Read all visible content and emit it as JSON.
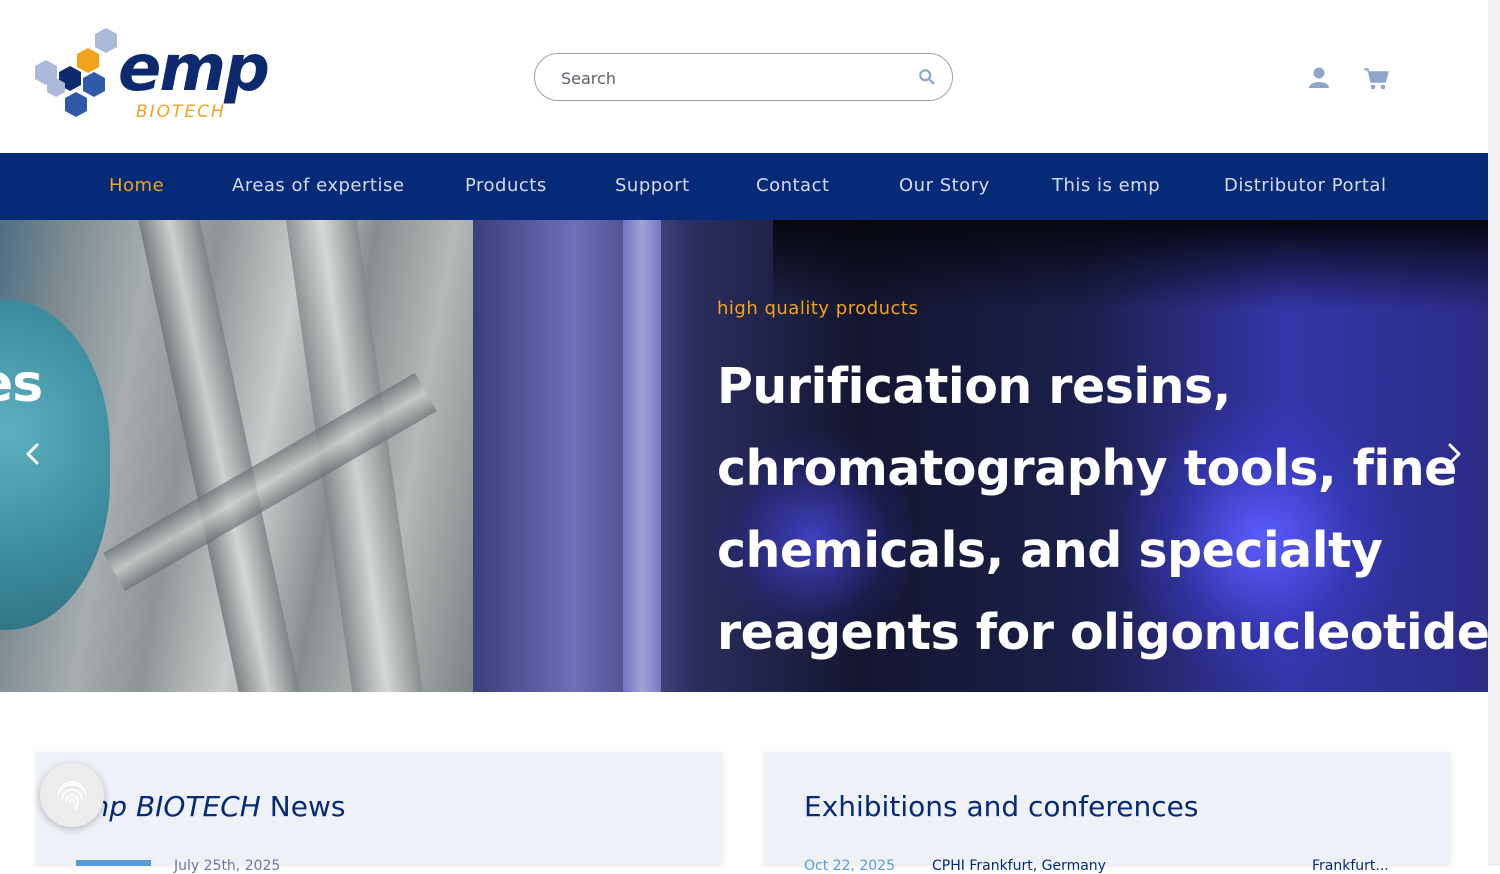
{
  "brand": {
    "name": "emp",
    "sub": "BIOTECH",
    "colors": {
      "navy": "#052a78",
      "orange": "#f0a31b",
      "lightblue": "#8fa6c9"
    }
  },
  "search": {
    "placeholder": "Search",
    "icon": "search-icon"
  },
  "header_icons": [
    "user-icon",
    "cart-icon"
  ],
  "nav": {
    "items": [
      {
        "label": "Home",
        "active": true
      },
      {
        "label": "Areas of expertise"
      },
      {
        "label": "Products"
      },
      {
        "label": "Support"
      },
      {
        "label": "Contact"
      },
      {
        "label": "Our Story"
      },
      {
        "label": "This is emp"
      },
      {
        "label": "Distributor Portal"
      }
    ]
  },
  "hero": {
    "prev_slide_text": "es",
    "eyebrow": "high quality products",
    "headline": "Purification resins, chromatography tools, fine chemicals, and specialty reagents for oligonucleotide",
    "headline_lines": [
      "Purification resins,",
      "chromatography tools, fine",
      "chemicals, and specialty",
      "reagents for oligonucleotide"
    ]
  },
  "news": {
    "title_italic": "mp BIOTECH",
    "title_rest": "News",
    "first_date": "July 25th, 2025"
  },
  "events": {
    "title": "Exhibitions and conferences",
    "first_date": "Oct 22, 2025",
    "first_name": "CPHI Frankfurt, Germany",
    "first_meta": "Frankfurt..."
  }
}
